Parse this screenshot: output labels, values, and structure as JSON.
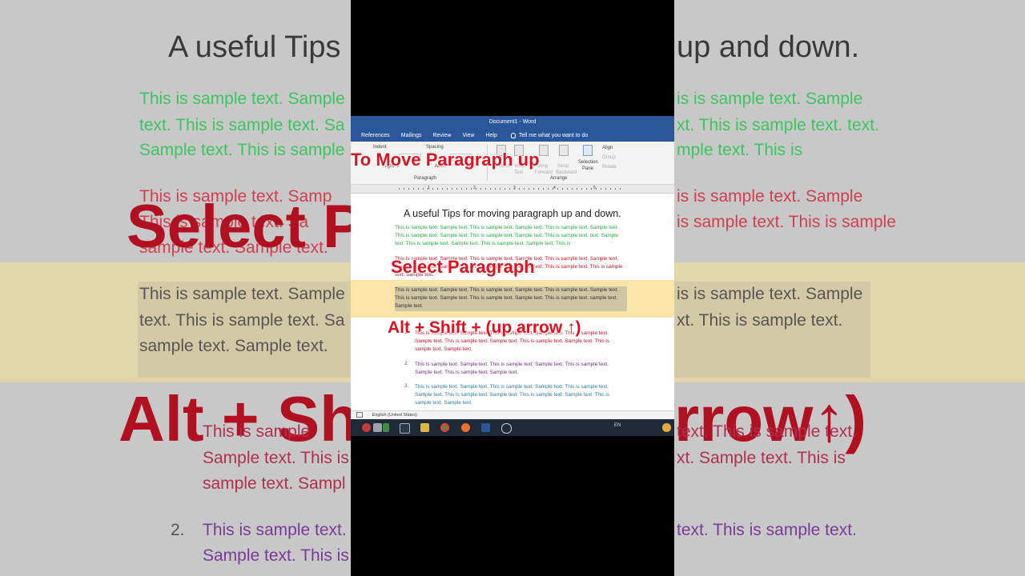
{
  "background": {
    "title_left": "A useful Tips",
    "title_right": "up and down.",
    "green_lines_left": [
      "This is sample text. Sample",
      "text. This is sample text. Sa",
      "Sample text. This is sample"
    ],
    "green_lines_right": [
      "is is sample text. Sample",
      "xt. This is sample text. text.",
      "mple text. This is"
    ],
    "red_lines_left": [
      "This is sample text. Samp",
      "This is sample text. Sa",
      "sample text. Sample text."
    ],
    "red_lines_right": [
      "is is sample text. Sample",
      "is sample text. This is sample"
    ],
    "sel_lines_left": [
      "This is sample text. Sample",
      "text. This is sample text. Sa",
      "sample text. Sample text."
    ],
    "sel_lines_right": [
      "is is sample text. Sample",
      "xt. This is sample text."
    ],
    "big_select": "Select P",
    "big_alt_left": "Alt + Sh",
    "big_alt_right": "rrow↑)",
    "list_lines_left": [
      "This is sample",
      "Sample text. This is",
      "sample text. Sampl"
    ],
    "list_lines_right": [
      "text. This is sample text.",
      "xt. Sample text. This is"
    ],
    "list2_num": "2.",
    "list2_left": [
      "This is sample text.",
      "Sample text. This is"
    ],
    "list2_right": [
      "text. This is sample text."
    ]
  },
  "window": {
    "title": "Document1  -  Word",
    "menu": [
      "References",
      "Mailings",
      "Review",
      "View",
      "Help"
    ],
    "tell_me": "Tell me what you want to do"
  },
  "ribbon": {
    "indent": "Indent",
    "right": "Right: 0\"",
    "spacing": "Spacing",
    "after": "After:",
    "paragraph_group": "Paragraph",
    "selection_pane": "Selection",
    "pane": "Pane",
    "align": "Align",
    "group": "Group",
    "rotate": "Rotate",
    "arrange_group": "Arrange",
    "position": "Position",
    "wrap": "Wrap",
    "bring": "Bring",
    "send": "Send",
    "forward": "Forward",
    "backward": "Backward",
    "text_label": "Text"
  },
  "ruler_numbers": [
    "1",
    "2",
    "3",
    "4",
    "5"
  ],
  "document": {
    "heading": "A useful Tips for moving paragraph up and down.",
    "para_green": "This is sample text. Sample text. This is sample text. Sample text. This is sample text. Sample text. This is sample text. Sample text. This is sample text. Sample text. This is sample text. text. Sample text. This is sample text. Sample text. This is sample text. Sample text. This is",
    "para_red": "This is sample text. Sample text. This is sample text. Sample text. This is sample text. Sample text. This is sample text. Sample text. This is sample text. Sample text. This is sample text. This is sample text. Sample text.",
    "para_selected": "This is sample text. Sample text. This is sample text. Sample text. This is sample text. Sample text. This is sample text. Sample text. This is sample text. Sample text. This is sample text. sample text. Sample text.",
    "list": [
      {
        "num": "1.",
        "text": "This is sample text. Sample text. This is sample text. Sample text. This is sample text. Sample text. This is sample text. Sample text. This is sample text. Sample text. This is sample text. Sample text."
      },
      {
        "num": "2.",
        "text": "This is sample text. Sample text. This is sample text. Sample text. This is sample text. Sample text. This is sample text. Sample text."
      },
      {
        "num": "3.",
        "text": "This is sample text. Sample text. This is sample text. Sample text. This is sample text. Sample text. This is sample text. Sample text. This is sample text. Sample text. This is sample text. Sample text."
      }
    ]
  },
  "status": {
    "language": "English (United States)"
  },
  "taskbar": {
    "lang": "EN"
  },
  "captions": {
    "move_up": "To Move Paragraph up",
    "select": "Select Paragraph",
    "shortcut": "Alt + Shift + (up arrow ↑)"
  },
  "colors": {
    "word_blue": "#2b579a",
    "caption_red": "#e0101e",
    "green_text": "#1fae3c",
    "red_text": "#c4142c",
    "highlight": "#fbe4a8"
  }
}
